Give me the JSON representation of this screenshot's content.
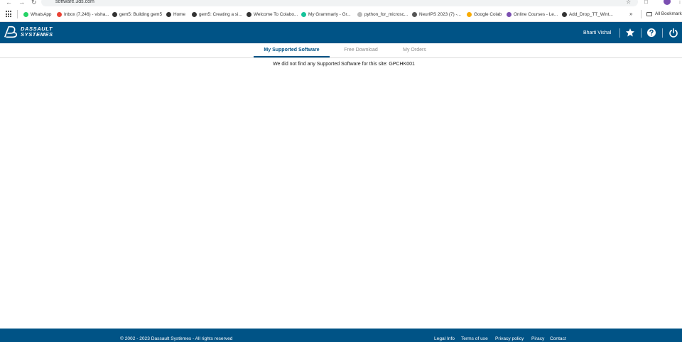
{
  "browser": {
    "url": "software.3ds.com",
    "bookmarks": [
      {
        "label": "WhatsApp",
        "color": "#25d366"
      },
      {
        "label": "Inbox (7,246) - visha...",
        "color": "#ea4335"
      },
      {
        "label": "gem5: Building gem5",
        "color": "#333333"
      },
      {
        "label": "Home",
        "color": "#333333"
      },
      {
        "label": "gem5: Creating a si...",
        "color": "#333333"
      },
      {
        "label": "Welcome To Colabo...",
        "color": "#333333"
      },
      {
        "label": "My Grammarly - Gr...",
        "color": "#15c39a"
      },
      {
        "label": "python_for_microsc...",
        "color": "#bbbbbb"
      },
      {
        "label": "NeurIPS 2023 (7) -...",
        "color": "#555555"
      },
      {
        "label": "Google Colab",
        "color": "#f9ab00"
      },
      {
        "label": "Online Courses - Le...",
        "color": "#7b4fb1"
      },
      {
        "label": "Add_Drop_TT_Wint...",
        "color": "#333333"
      }
    ],
    "all_bookmarks": "All Bookmarks"
  },
  "header": {
    "logo_line1": "DASSAULT",
    "logo_line2": "SYSTEMES",
    "user_name": "Bharti Vishal",
    "icons": [
      "star-icon",
      "help-icon",
      "power-icon"
    ]
  },
  "tabs": [
    {
      "label": "My Supported Software",
      "active": true
    },
    {
      "label": "Free Download",
      "active": false
    },
    {
      "label": "My Orders",
      "active": false
    }
  ],
  "main": {
    "message": "We did not find any Supported Software for this site: GPCHK001"
  },
  "footer": {
    "copyright": "© 2002 - 2023 Dassault Systèmes - All rights reserved",
    "links": [
      "Legal Info",
      "Terms of use",
      "Privacy policy",
      "Piracy",
      "Contact"
    ]
  },
  "colors": {
    "brand": "#005386",
    "tab_inactive": "#8c8c8c"
  }
}
